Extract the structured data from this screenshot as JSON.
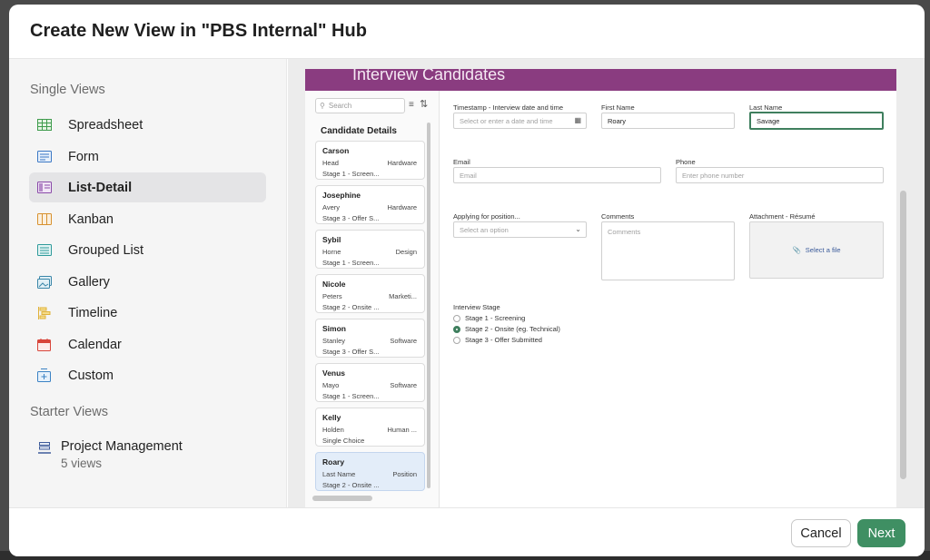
{
  "modal": {
    "title": "Create New View in \"PBS Internal\" Hub"
  },
  "sidebar": {
    "single_views_title": "Single Views",
    "items": [
      {
        "label": "Spreadsheet",
        "icon": "spreadsheet-icon"
      },
      {
        "label": "Form",
        "icon": "form-icon"
      },
      {
        "label": "List-Detail",
        "icon": "list-detail-icon",
        "active": true
      },
      {
        "label": "Kanban",
        "icon": "kanban-icon"
      },
      {
        "label": "Grouped List",
        "icon": "grouped-list-icon"
      },
      {
        "label": "Gallery",
        "icon": "gallery-icon"
      },
      {
        "label": "Timeline",
        "icon": "timeline-icon"
      },
      {
        "label": "Calendar",
        "icon": "calendar-icon"
      },
      {
        "label": "Custom",
        "icon": "custom-icon"
      }
    ],
    "starter_views_title": "Starter Views",
    "starter": {
      "label": "Project Management",
      "sub": "5 views",
      "icon": "project-management-icon"
    }
  },
  "preview": {
    "banner_title": "Interview Candidates",
    "banner_color": "#8a3c80",
    "list": {
      "search_placeholder": "Search",
      "header": "Candidate Details",
      "cards": [
        {
          "name": "Carson",
          "sub": "Head",
          "right": "Hardware",
          "stage": "Stage 1 - Screen..."
        },
        {
          "name": "Josephine",
          "sub": "Avery",
          "right": "Hardware",
          "stage": "Stage 3 - Offer S..."
        },
        {
          "name": "Sybil",
          "sub": "Horne",
          "right": "Design",
          "stage": "Stage 1 - Screen..."
        },
        {
          "name": "Nicole",
          "sub": "Peters",
          "right": "Marketi...",
          "stage": "Stage 2 - Onsite ..."
        },
        {
          "name": "Simon",
          "sub": "Stanley",
          "right": "Software",
          "stage": "Stage 3 - Offer S..."
        },
        {
          "name": "Venus",
          "sub": "Mayo",
          "right": "Software",
          "stage": "Stage 1 - Screen..."
        },
        {
          "name": "Kelly",
          "sub": "Holden",
          "right": "Human ...",
          "stage": "Single Choice"
        },
        {
          "name": "Roary",
          "sub": "Last Name",
          "right": "Position",
          "stage": "Stage 2 - Onsite ...",
          "selected": true
        }
      ]
    },
    "form": {
      "timestamp_label": "Timestamp - Interview date and time",
      "timestamp_placeholder": "Select or enter a date and time",
      "first_name_label": "First Name",
      "first_name_value": "Roary",
      "last_name_label": "Last Name",
      "last_name_value": "Savage",
      "email_label": "Email",
      "email_placeholder": "Email",
      "phone_label": "Phone",
      "phone_placeholder": "Enter phone number",
      "position_label": "Applying for position...",
      "position_placeholder": "Select an option",
      "comments_label": "Comments",
      "comments_placeholder": "Comments",
      "attachment_label": "Attachment - Résumé",
      "attachment_action": "Select a file",
      "stage_label": "Interview Stage",
      "stages": [
        {
          "label": "Stage 1 - Screening",
          "checked": false
        },
        {
          "label": "Stage 2 - Onsite (eg. Technical)",
          "checked": true
        },
        {
          "label": "Stage 3 - Offer Submitted",
          "checked": false
        }
      ]
    }
  },
  "footer": {
    "cancel_label": "Cancel",
    "next_label": "Next"
  },
  "colors": {
    "accent": "#3f8f63",
    "active_nav_bg": "#e4e4e6"
  }
}
